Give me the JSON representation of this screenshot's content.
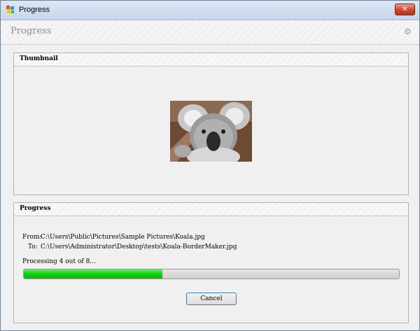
{
  "window": {
    "title": "Progress",
    "close_label": "✕"
  },
  "header": {
    "title": "Progress",
    "settings_icon": "gear-icon"
  },
  "thumbnail": {
    "title": "Thumbnail",
    "image_icon": "koala-thumbnail"
  },
  "progress": {
    "title": "Progress",
    "from_label": "From:",
    "from_value": "C:\\Users\\Public\\Pictures\\Sample Pictures\\Koala.jpg",
    "to_label": "To:",
    "to_value": "C:\\Users\\Administrator\\Desktop\\tests\\Koala-BorderMaker.jpg",
    "status": "Processing 4 out of 8...",
    "current": 4,
    "total": 8,
    "fraction": 0.37,
    "cancel_label": "Cancel"
  },
  "colors": {
    "progress_fill": "#0fd10f",
    "close_button": "#c9462c",
    "cancel_border": "#3c7fb1"
  }
}
